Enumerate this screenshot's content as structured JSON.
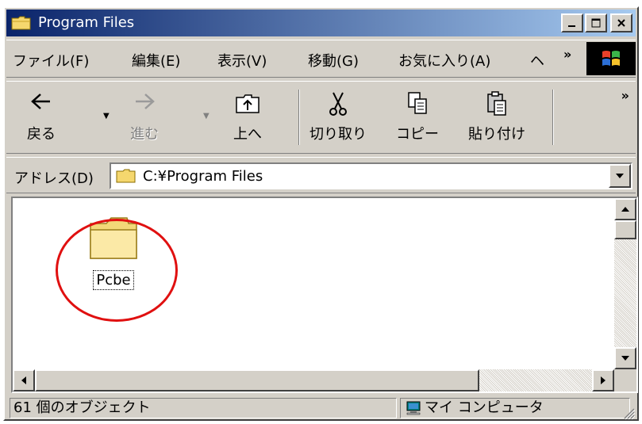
{
  "window": {
    "title": "Program Files"
  },
  "titlebar": {
    "minimize_icon": "minimize-icon",
    "maximize_icon": "maximize-icon",
    "close_icon": "close-icon"
  },
  "menubar": {
    "items": [
      {
        "label": "ファイル(F)"
      },
      {
        "label": "編集(E)"
      },
      {
        "label": "表示(V)"
      },
      {
        "label": "移動(G)"
      },
      {
        "label": "お気に入り(A)"
      },
      {
        "label": "ヘ"
      }
    ],
    "overflow": "»"
  },
  "toolbar": {
    "back": {
      "label": "戻る",
      "icon": "back-arrow-icon"
    },
    "forward": {
      "label": "進む",
      "icon": "forward-arrow-icon"
    },
    "up": {
      "label": "上へ",
      "icon": "up-folder-icon"
    },
    "cut": {
      "label": "切り取り",
      "icon": "scissors-icon"
    },
    "copy": {
      "label": "コピー",
      "icon": "copy-icon"
    },
    "paste": {
      "label": "貼り付け",
      "icon": "paste-icon"
    },
    "overflow": "»"
  },
  "address": {
    "label": "アドレス(D)",
    "value": "C:¥Program Files"
  },
  "content": {
    "items": [
      {
        "name": "Pcbe",
        "icon": "folder-icon"
      }
    ]
  },
  "status": {
    "objects": "61 個のオブジェクト",
    "location": "マイ コンピュータ"
  },
  "colors": {
    "titlebar_start": "#0a246a",
    "titlebar_end": "#a6caf0",
    "chrome": "#d4d0c8",
    "highlight_ring": "#e01010"
  }
}
